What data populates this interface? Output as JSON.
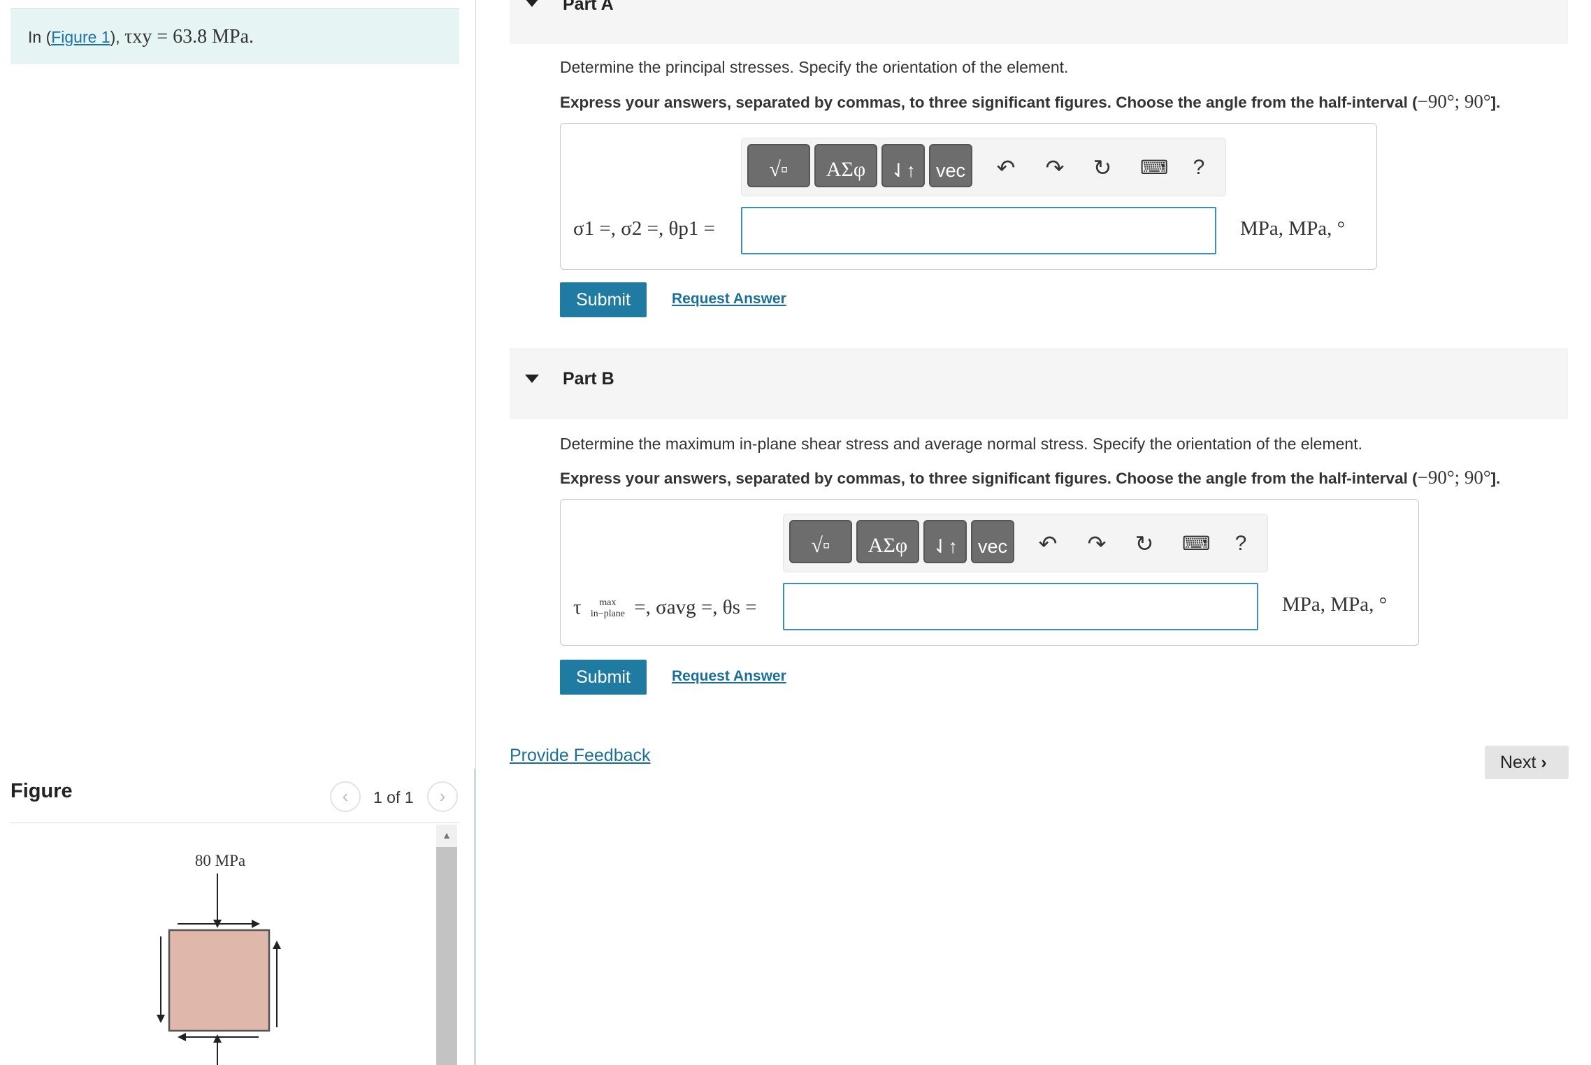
{
  "problem": {
    "prefix": "In (",
    "figure_link": "Figure 1",
    "suffix": "), ",
    "math": "τxy = 63.8 MPa."
  },
  "figure_panel": {
    "title": "Figure",
    "pager": "1 of 1",
    "prev_icon": "chevron-left-icon",
    "next_icon": "chevron-right-icon",
    "diagram": {
      "top_label": "80 MPa",
      "fill_color": "#dfb8ab"
    }
  },
  "partA": {
    "title": "Part A",
    "prompt": "Determine the principal stresses. Specify the orientation of the element.",
    "instruction": "Express your answers, separated by commas, to three significant figures. Choose the angle from the half-interval (",
    "interval": "−90°; 90°",
    "instruction_end": "].",
    "label": "σ1 =, σ2 =, θp1 =",
    "units": "MPa,  MPa,  °",
    "input_value": "",
    "submit": "Submit",
    "request": "Request Answer"
  },
  "partB": {
    "title": "Part B",
    "prompt": "Determine the maximum in-plane shear stress and average normal stress. Specify the orientation of the element.",
    "instruction": "Express your answers, separated by commas, to three significant figures. Choose the angle from the half-interval (",
    "interval": "−90°; 90°",
    "instruction_end": "].",
    "label_tau": "τ",
    "label_max": "max",
    "label_inplane": "in−plane",
    "label_rest": "=, σavg =, θs =",
    "units": "MPa,  MPa,  °",
    "input_value": "",
    "submit": "Submit",
    "request": "Request Answer"
  },
  "toolbar": {
    "templates": "√▫",
    "greek": "ΑΣφ",
    "arrows": "⇃↑",
    "vec": "vec",
    "help": "?"
  },
  "footer": {
    "feedback": "Provide Feedback",
    "next": "Next"
  }
}
